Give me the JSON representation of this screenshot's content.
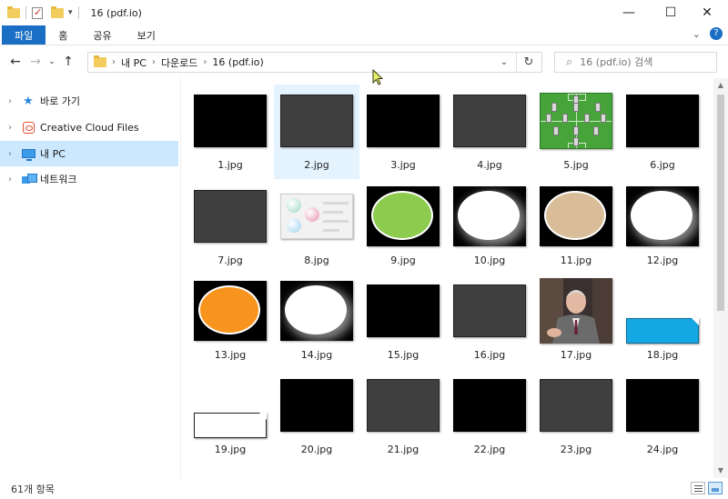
{
  "window": {
    "title": "16 (pdf.io)",
    "controls": {
      "minimize": "—",
      "maximize": "☐",
      "close": "✕"
    }
  },
  "ribbon": {
    "tabs": [
      "파일",
      "홈",
      "공유",
      "보기"
    ],
    "expand_glyph": "⌄",
    "help_glyph": "?"
  },
  "address": {
    "crumbs": [
      "내 PC",
      "다운로드",
      "16 (pdf.io)"
    ],
    "search_placeholder": "16 (pdf.io) 검색"
  },
  "nav": {
    "items": [
      {
        "label": "바로 가기",
        "icon": "star-icon",
        "selected": false
      },
      {
        "label": "Creative Cloud Files",
        "icon": "creative-cloud-icon",
        "selected": false
      },
      {
        "label": "내 PC",
        "icon": "pc-icon",
        "selected": true
      },
      {
        "label": "네트워크",
        "icon": "network-icon",
        "selected": false
      }
    ]
  },
  "files": [
    {
      "name": "1.jpg",
      "kind": "black"
    },
    {
      "name": "2.jpg",
      "kind": "gray",
      "selected": true
    },
    {
      "name": "3.jpg",
      "kind": "black"
    },
    {
      "name": "4.jpg",
      "kind": "gray"
    },
    {
      "name": "5.jpg",
      "kind": "soccer"
    },
    {
      "name": "6.jpg",
      "kind": "black"
    },
    {
      "name": "7.jpg",
      "kind": "gray"
    },
    {
      "name": "8.jpg",
      "kind": "diagram"
    },
    {
      "name": "9.jpg",
      "kind": "ellipse",
      "fill": "#8dcb4f"
    },
    {
      "name": "10.jpg",
      "kind": "ellipse-glow",
      "fill": "#ffffff"
    },
    {
      "name": "11.jpg",
      "kind": "ellipse",
      "fill": "#d8bd98"
    },
    {
      "name": "12.jpg",
      "kind": "ellipse-glow",
      "fill": "#ffffff"
    },
    {
      "name": "13.jpg",
      "kind": "ellipse",
      "fill": "#f7941d"
    },
    {
      "name": "14.jpg",
      "kind": "ellipse-glow",
      "fill": "#ffffff"
    },
    {
      "name": "15.jpg",
      "kind": "black"
    },
    {
      "name": "16.jpg",
      "kind": "gray"
    },
    {
      "name": "17.jpg",
      "kind": "photo"
    },
    {
      "name": "18.jpg",
      "kind": "blueshape"
    },
    {
      "name": "19.jpg",
      "kind": "whiteshape"
    },
    {
      "name": "20.jpg",
      "kind": "black"
    },
    {
      "name": "21.jpg",
      "kind": "gray"
    },
    {
      "name": "22.jpg",
      "kind": "black"
    },
    {
      "name": "23.jpg",
      "kind": "gray"
    },
    {
      "name": "24.jpg",
      "kind": "black"
    }
  ],
  "status": {
    "count_text": "61개 항목"
  },
  "colors": {
    "accent": "#1a6ec3",
    "selection": "#cce8ff",
    "item_selection": "#e5f3ff"
  }
}
